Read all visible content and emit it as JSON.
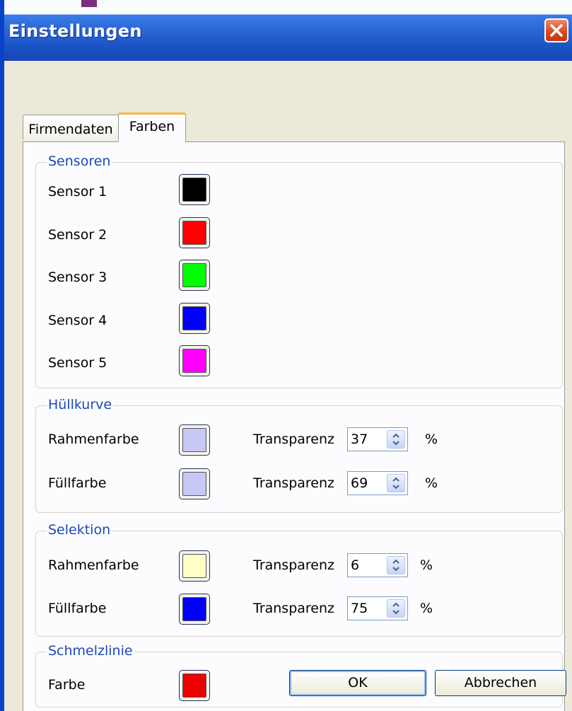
{
  "window": {
    "title": "Einstellungen"
  },
  "tabs": [
    {
      "label": "Firmendaten"
    },
    {
      "label": "Farben"
    }
  ],
  "sensoren": {
    "legend": "Sensoren",
    "items": [
      {
        "label": "Sensor 1",
        "color": "#000000"
      },
      {
        "label": "Sensor 2",
        "color": "#ff0000"
      },
      {
        "label": "Sensor 3",
        "color": "#00ff00"
      },
      {
        "label": "Sensor 4",
        "color": "#0000ff"
      },
      {
        "label": "Sensor 5",
        "color": "#ff00ff"
      }
    ]
  },
  "huellkurve": {
    "legend": "Hüllkurve",
    "rahmen": {
      "label": "Rahmenfarbe",
      "color": "#c8c8f6",
      "transparency_label": "Transparenz",
      "transparency": "37",
      "unit": "%"
    },
    "fuell": {
      "label": "Füllfarbe",
      "color": "#c8c8f6",
      "transparency_label": "Transparenz",
      "transparency": "69",
      "unit": "%"
    }
  },
  "selektion": {
    "legend": "Selektion",
    "rahmen": {
      "label": "Rahmenfarbe",
      "color": "#ffffc8",
      "transparency_label": "Transparenz",
      "transparency": "6",
      "unit": "%"
    },
    "fuell": {
      "label": "Füllfarbe",
      "color": "#0000ff",
      "transparency_label": "Transparenz",
      "transparency": "75",
      "unit": "%"
    }
  },
  "schmelzlinie": {
    "legend": "Schmelzlinie",
    "farbe": {
      "label": "Farbe",
      "color": "#ee0000"
    }
  },
  "buttons": {
    "ok": "OK",
    "cancel": "Abbrechen"
  }
}
